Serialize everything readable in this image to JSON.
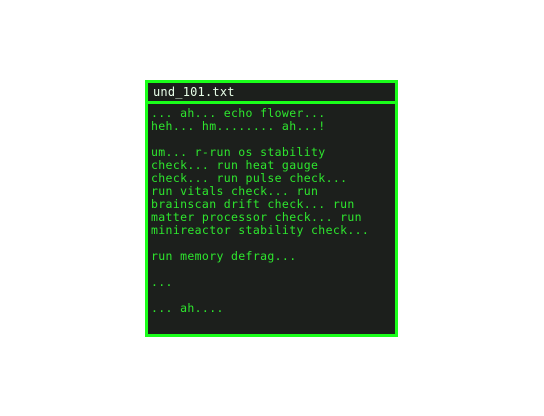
{
  "window": {
    "title": "und_101.txt"
  },
  "document": {
    "lines": [
      "... ah... echo flower...",
      "heh... hm........ ah...!",
      "",
      "um... r-run os stability",
      "check... run heat gauge",
      "check... run pulse check...",
      "run vitals check... run",
      "brainscan drift check... run",
      "matter processor check... run",
      "minireactor stability check...",
      "",
      "run memory defrag...",
      "",
      "...",
      "",
      "... ah...."
    ]
  },
  "colors": {
    "border": "#1aff1a",
    "text": "#2ee62e",
    "background": "#1c1f1c",
    "title_text": "#e8ffe8"
  }
}
